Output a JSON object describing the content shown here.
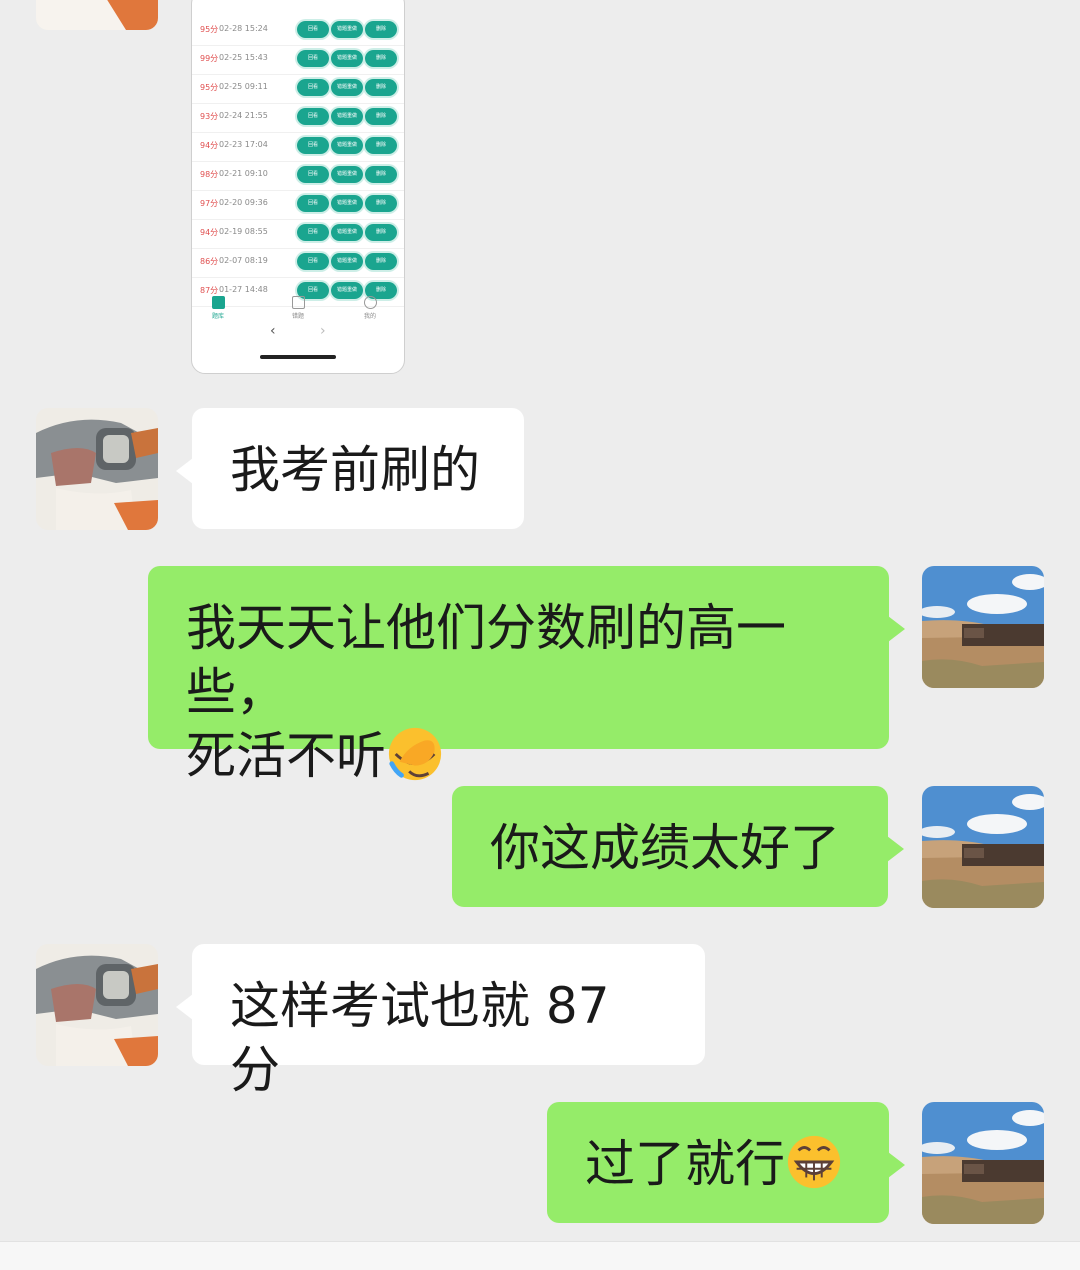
{
  "screenshot": {
    "rows": [
      {
        "score": "95分",
        "time": "02-28 15:24"
      },
      {
        "score": "99分",
        "time": "02-25 15:43"
      },
      {
        "score": "95分",
        "time": "02-25 09:11"
      },
      {
        "score": "93分",
        "time": "02-24 21:55"
      },
      {
        "score": "94分",
        "time": "02-23 17:04"
      },
      {
        "score": "98分",
        "time": "02-21 09:10"
      },
      {
        "score": "97分",
        "time": "02-20 09:36"
      },
      {
        "score": "94分",
        "time": "02-19 08:55"
      },
      {
        "score": "86分",
        "time": "02-07 08:19"
      },
      {
        "score": "87分",
        "time": "01-27 14:48"
      }
    ],
    "buttons": [
      "回看",
      "错题重做",
      "删除"
    ],
    "tabs": [
      "题库",
      "错题",
      "我的"
    ],
    "nav_back": "‹",
    "nav_forward": "›"
  },
  "messages": [
    {
      "side": "left",
      "text": "我考前刷的"
    },
    {
      "side": "right",
      "text": "我天天让他们分数刷的高一些，",
      "text2": "死活不听",
      "emoji": "face-palm-crying"
    },
    {
      "side": "right",
      "text": "你这成绩太好了"
    },
    {
      "side": "left",
      "text": "这样考试也就 87 分"
    },
    {
      "side": "right",
      "text": "过了就行",
      "emoji": "grinning-face"
    }
  ],
  "colors": {
    "background": "#ededed",
    "sent_bubble": "#95ec69",
    "received_bubble": "#ffffff",
    "accent": "#1aa58f"
  }
}
